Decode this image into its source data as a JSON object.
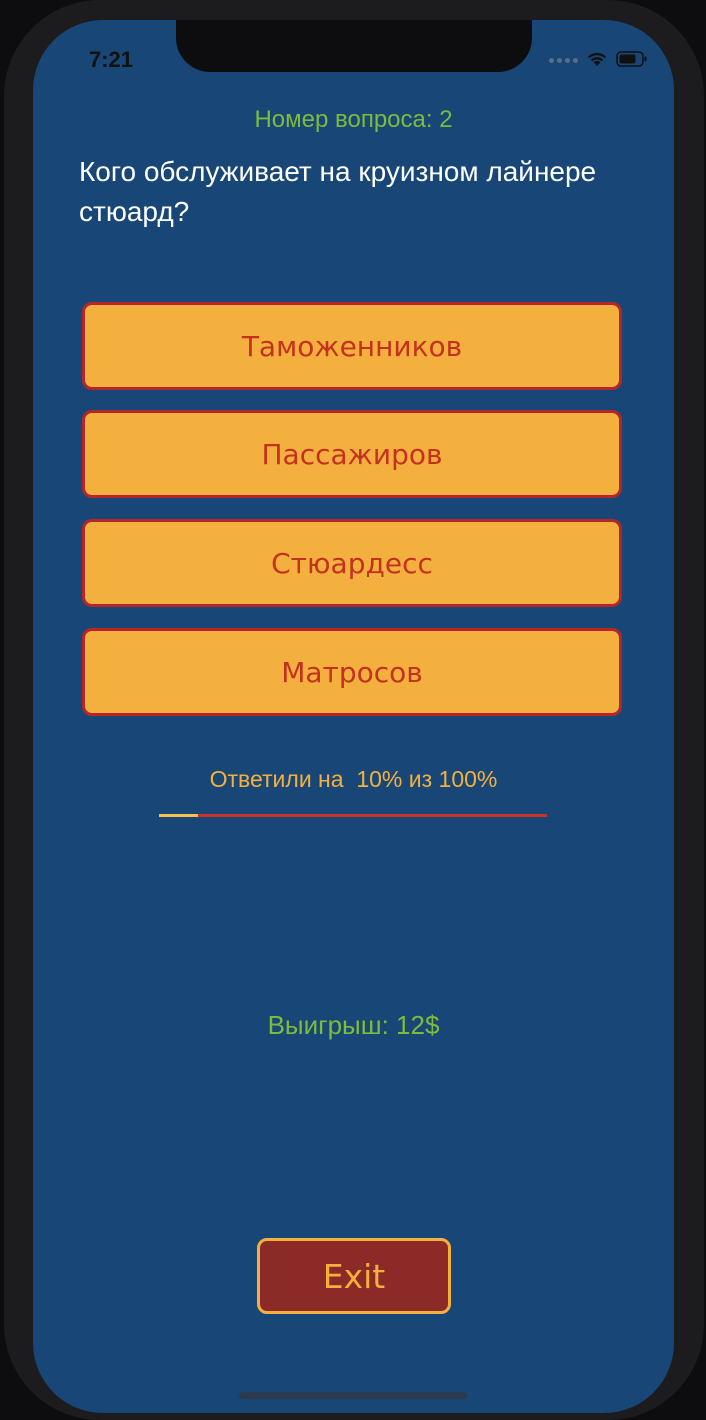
{
  "status_bar": {
    "time": "7:21",
    "icons": [
      "signal-dots-icon",
      "wifi-icon",
      "battery-icon"
    ]
  },
  "quiz": {
    "question_number": "Номер вопроса: 2",
    "question": "Кого обслуживает на круизном лайнере стюард?",
    "answers": [
      {
        "label": "Таможенников"
      },
      {
        "label": "Пассажиров"
      },
      {
        "label": "Стюардесс"
      },
      {
        "label": "Матросов"
      }
    ]
  },
  "progress": {
    "label": "Ответили на  10% из 100%",
    "value_percent": 10
  },
  "winnings": {
    "label": "Выигрыш: 12$"
  },
  "actions": {
    "exit_label": "Exit"
  },
  "colors": {
    "background": "#184777",
    "answer_fill": "#f4b03f",
    "answer_border": "#b5262a",
    "answer_text": "#c5311f",
    "accent_green": "#7dbb3c",
    "exit_fill": "#8c2a27",
    "progress_fill": "#f4c14a",
    "progress_track": "#c9322a"
  }
}
